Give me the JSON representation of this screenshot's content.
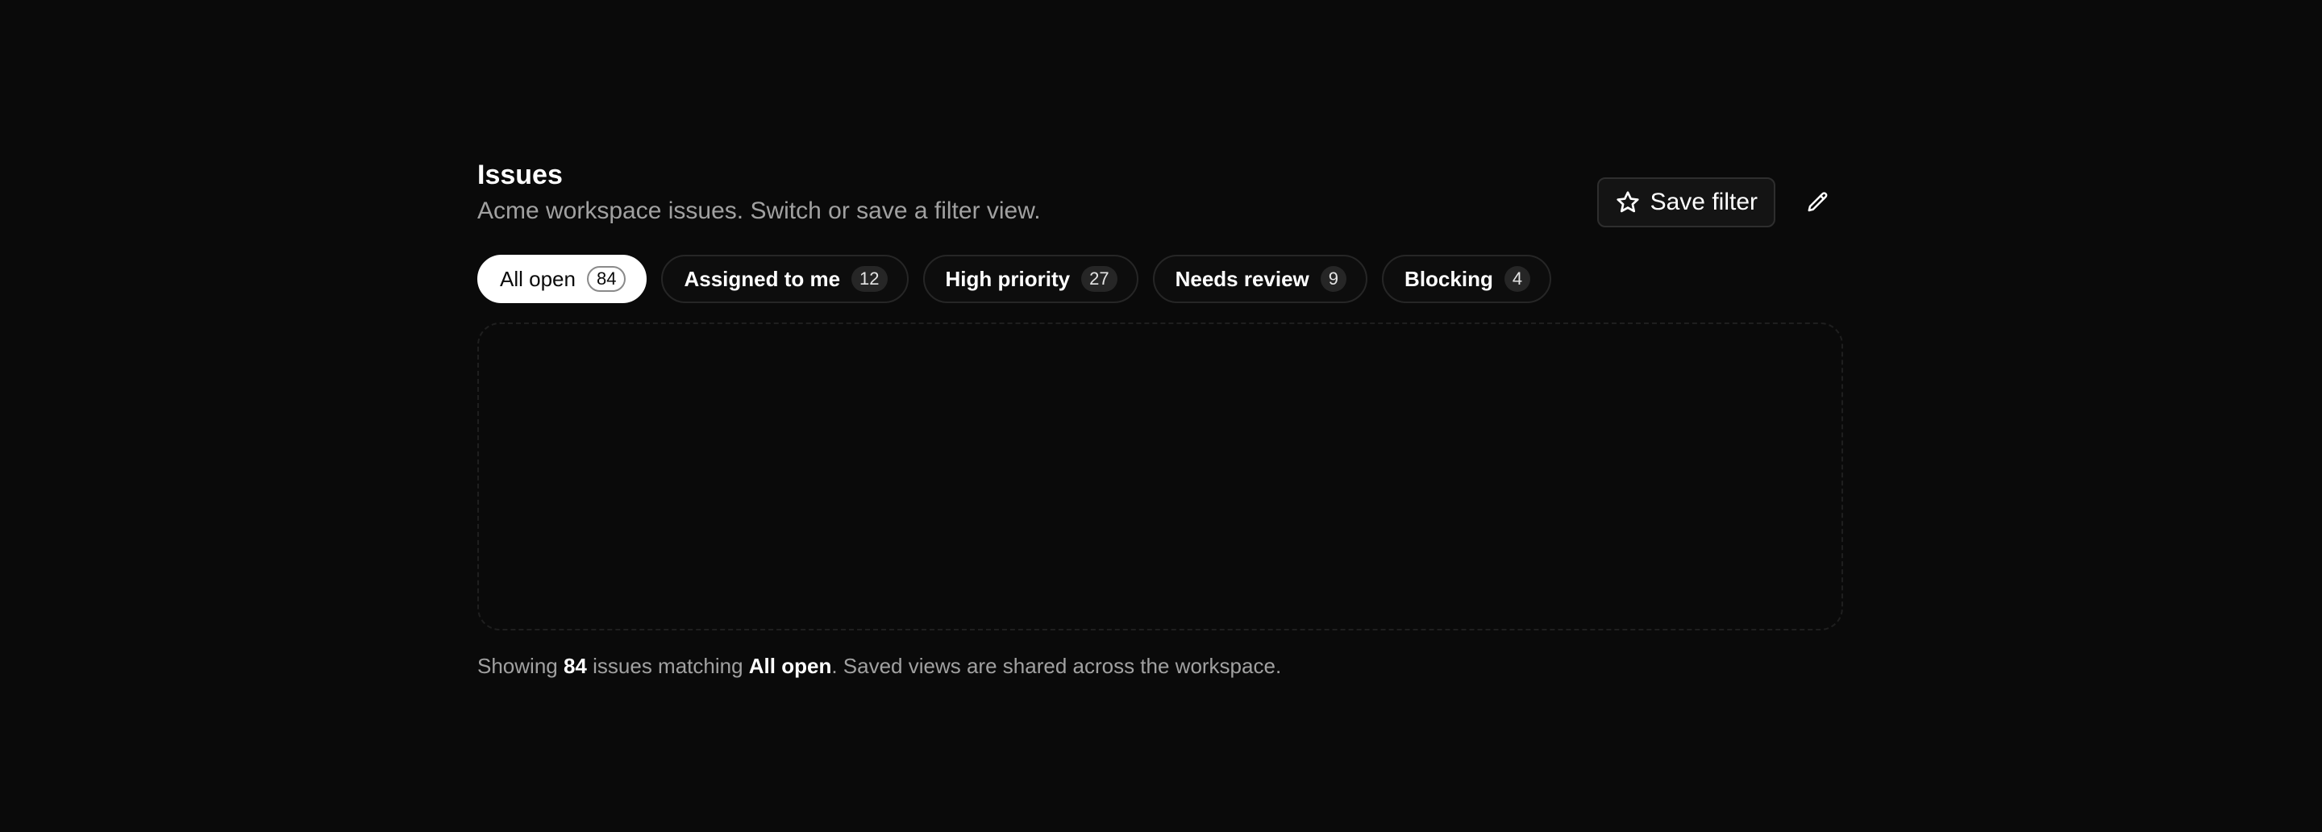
{
  "header": {
    "title": "Issues",
    "subtitle": "Acme workspace issues. Switch or save a filter view."
  },
  "actions": {
    "save_label": "Save filter",
    "save_icon": "star-icon",
    "edit_icon": "pencil-icon"
  },
  "tabs": [
    {
      "label": "All open",
      "count": "84",
      "active": true
    },
    {
      "label": "Assigned to me",
      "count": "12",
      "active": false
    },
    {
      "label": "High priority",
      "count": "27",
      "active": false
    },
    {
      "label": "Needs review",
      "count": "9",
      "active": false
    },
    {
      "label": "Blocking",
      "count": "4",
      "active": false
    }
  ],
  "footer": {
    "prefix": "Showing",
    "count": "84",
    "middle": "issues matching",
    "view": "All open",
    "suffix": ". Saved views are shared across the workspace."
  },
  "colors": {
    "background": "#0a0a0a",
    "text": "#ffffff",
    "muted": "#a1a1a1",
    "border": "#262626"
  }
}
